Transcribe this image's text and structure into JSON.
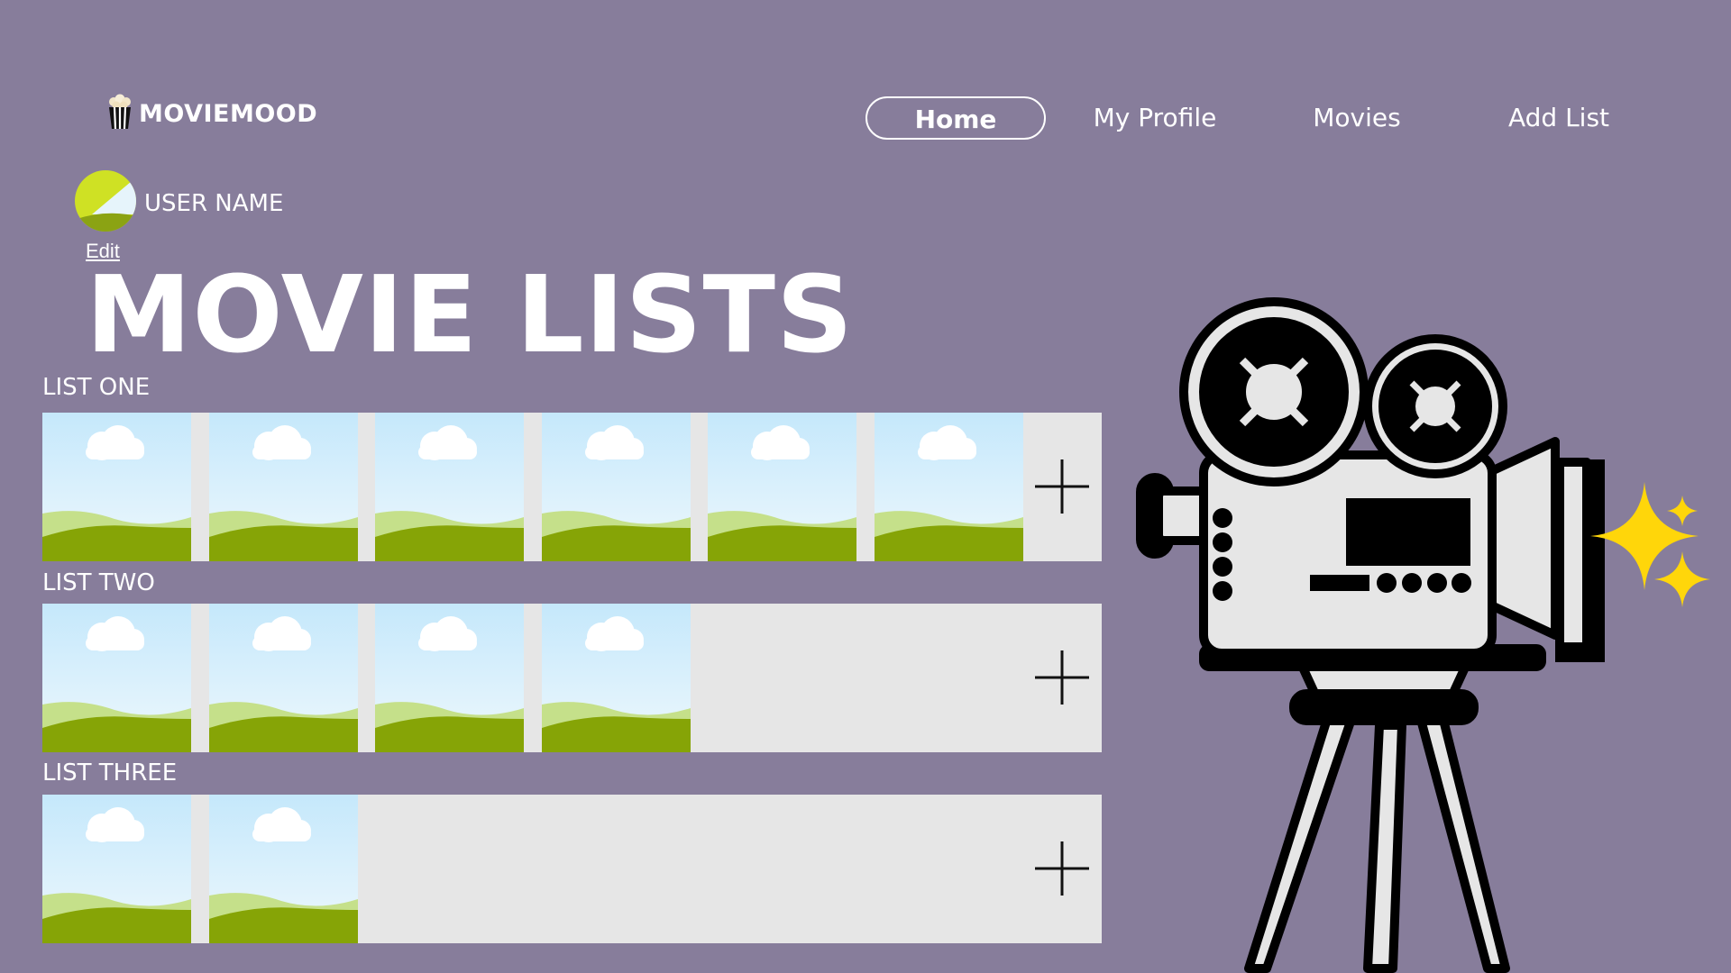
{
  "app": {
    "name": "MOVIEMOOD"
  },
  "nav": {
    "home": "Home",
    "profile": "My Profile",
    "movies": "Movies",
    "add_list": "Add List"
  },
  "user": {
    "name": "USER NAME",
    "edit": "Edit"
  },
  "page": {
    "title": "MOVIE LISTS"
  },
  "lists": [
    {
      "label": "LIST ONE",
      "movie_count": 6
    },
    {
      "label": "LIST TWO",
      "movie_count": 4
    },
    {
      "label": "LIST THREE",
      "movie_count": 2
    }
  ],
  "icons": {
    "logo": "popcorn-icon",
    "avatar": "avatar-icon",
    "thumbnail": "landscape-image-icon",
    "add": "plus-icon",
    "decoration": "film-camera-icon",
    "sparkle": "sparkle-icon"
  },
  "colors": {
    "background": "#877d9b",
    "row": "#e6e6e6",
    "sparkle": "#ffd60a",
    "avatar": "#cfe124"
  }
}
